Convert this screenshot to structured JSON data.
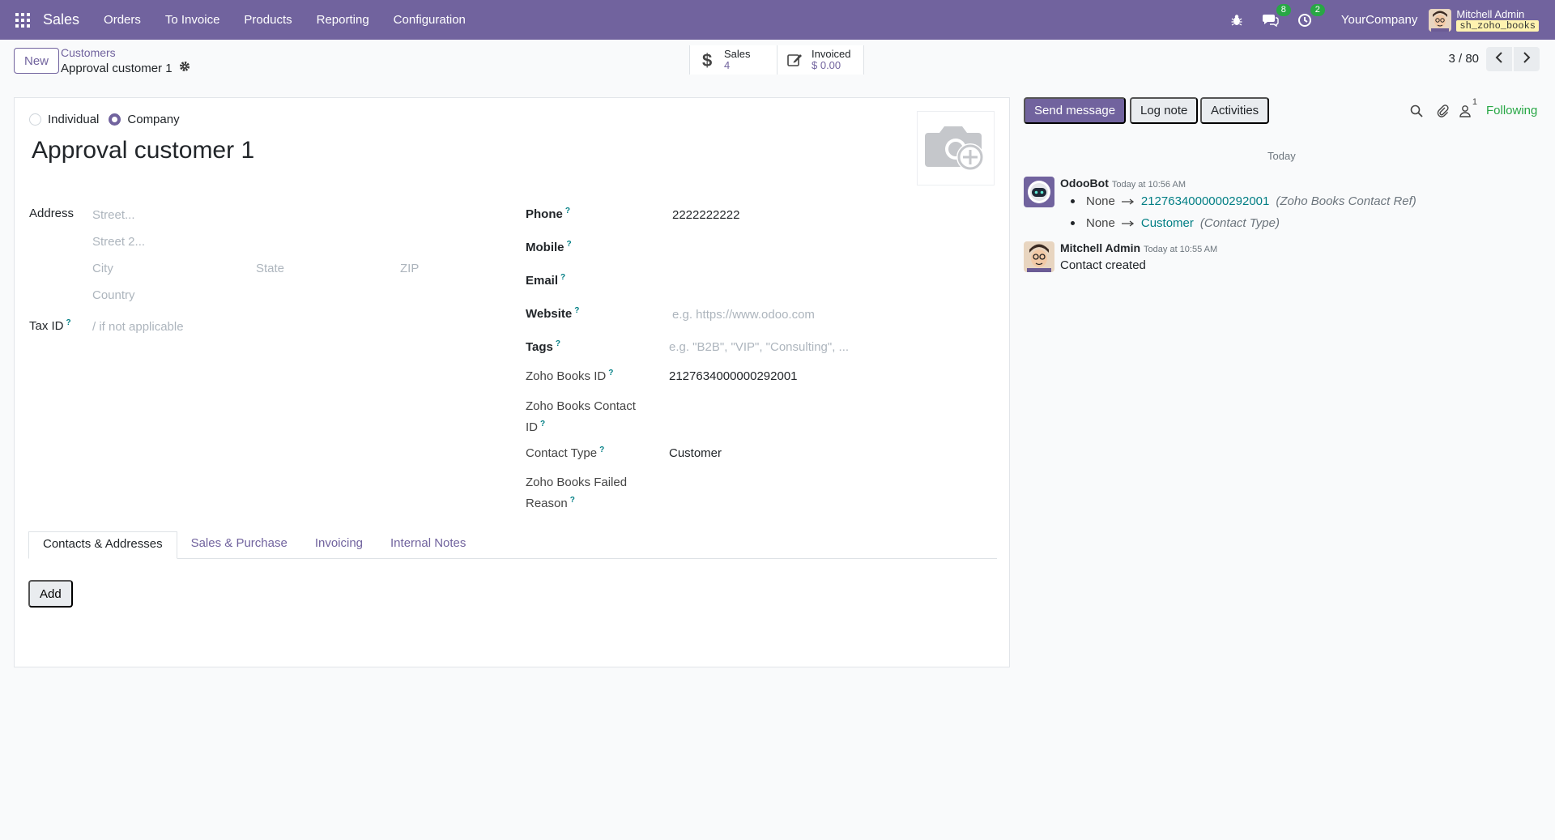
{
  "navbar": {
    "app_name": "Sales",
    "menu": [
      "Orders",
      "To Invoice",
      "Products",
      "Reporting",
      "Configuration"
    ],
    "messages_count": "8",
    "activities_count": "2",
    "company": "YourCompany",
    "user_name": "Mitchell Admin",
    "database": "sh_zoho_books",
    "icons": [
      "apps-grid-icon",
      "bug-icon",
      "chat-bubbles-icon",
      "clock-icon"
    ]
  },
  "control": {
    "new_label": "New",
    "breadcrumb_parent": "Customers",
    "breadcrumb_current": "Approval customer 1",
    "smart_buttons": [
      {
        "label": "Sales",
        "value": "4",
        "icon": "dollar-icon"
      },
      {
        "label": "Invoiced",
        "value": "$ 0.00",
        "icon": "edit-icon"
      }
    ],
    "pager": "3 / 80"
  },
  "form": {
    "type_options": [
      "Individual",
      "Company"
    ],
    "selected_type": "Company",
    "name": "Approval customer 1",
    "address_label": "Address",
    "street_placeholder": "Street...",
    "street2_placeholder": "Street 2...",
    "city_placeholder": "City",
    "state_placeholder": "State",
    "zip_placeholder": "ZIP",
    "country_placeholder": "Country",
    "tax_id_label": "Tax ID",
    "tax_id_placeholder": "/ if not applicable",
    "phone_label": "Phone",
    "phone_value": "2222222222",
    "mobile_label": "Mobile",
    "email_label": "Email",
    "website_label": "Website",
    "website_placeholder": "e.g. https://www.odoo.com",
    "tags_label": "Tags",
    "tags_placeholder": "e.g. \"B2B\", \"VIP\", \"Consulting\", ...",
    "zoho_books_id_label": "Zoho Books ID",
    "zoho_books_id_value": "2127634000000292001",
    "zoho_contact_id_label_1": "Zoho Books Contact",
    "zoho_contact_id_label_2": "ID",
    "contact_type_label": "Contact Type",
    "contact_type_value": "Customer",
    "zoho_failed_label_1": "Zoho Books Failed",
    "zoho_failed_label_2": "Reason",
    "help_mark": "?"
  },
  "tabs": [
    "Contacts & Addresses",
    "Sales & Purchase",
    "Invoicing",
    "Internal Notes"
  ],
  "add_label": "Add",
  "chatter": {
    "send_message": "Send message",
    "log_note": "Log note",
    "activities": "Activities",
    "followers_count": "1",
    "following": "Following",
    "date_separator": "Today",
    "messages": [
      {
        "author": "OdooBot",
        "time": "Today at 10:56 AM",
        "tracking": [
          {
            "old": "None",
            "new": "2127634000000292001",
            "field": "(Zoho Books Contact Ref)"
          },
          {
            "old": "None",
            "new": "Customer",
            "field": "(Contact Type)"
          }
        ]
      },
      {
        "author": "Mitchell Admin",
        "time": "Today at 10:55 AM",
        "body": "Contact created"
      }
    ]
  }
}
